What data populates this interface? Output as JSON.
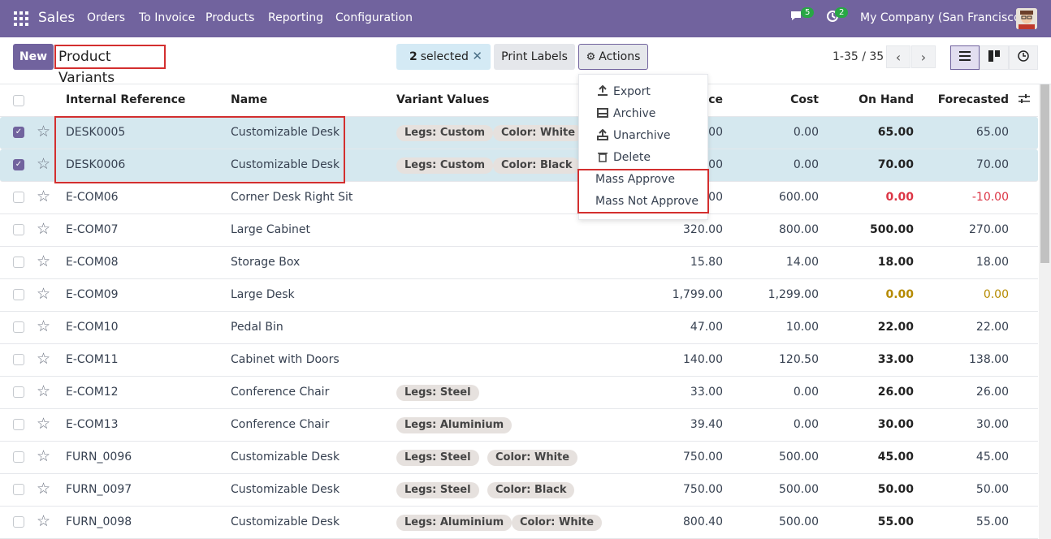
{
  "topbar": {
    "app": "Sales",
    "menus": [
      "Orders",
      "To Invoice",
      "Products",
      "Reporting",
      "Configuration"
    ],
    "chat_count": "5",
    "activity_count": "2",
    "company": "My Company (San Francisco)"
  },
  "control": {
    "new_label": "New",
    "title": "Product Variants",
    "selected_count": "2",
    "selected_label": "selected",
    "print_label": "Print Labels",
    "actions_label": "Actions",
    "pager": "1-35 / 35"
  },
  "actions_menu": [
    "Export",
    "Archive",
    "Unarchive",
    "Delete",
    "Mass Approve",
    "Mass Not Approve"
  ],
  "columns": [
    "Internal Reference",
    "Name",
    "Variant Values",
    "ice",
    "Cost",
    "On Hand",
    "Forecasted"
  ],
  "rows": [
    {
      "ref": "DESK0005",
      "name": "Customizable Desk",
      "tags": [
        "Legs: Custom",
        "Color: White"
      ],
      "price": ".00",
      "cost": "0.00",
      "onhand": "65.00",
      "forecast": "65.00",
      "selected": true
    },
    {
      "ref": "DESK0006",
      "name": "Customizable Desk",
      "tags": [
        "Legs: Custom",
        "Color: Black"
      ],
      "price": ".00",
      "cost": "0.00",
      "onhand": "70.00",
      "forecast": "70.00",
      "selected": true
    },
    {
      "ref": "E-COM06",
      "name": "Corner Desk Right Sit",
      "tags": [],
      "price": ".00",
      "cost": "600.00",
      "onhand": "0.00",
      "forecast": "-10.00",
      "status": "red"
    },
    {
      "ref": "E-COM07",
      "name": "Large Cabinet",
      "tags": [],
      "price": "320.00",
      "cost": "800.00",
      "onhand": "500.00",
      "forecast": "270.00"
    },
    {
      "ref": "E-COM08",
      "name": "Storage Box",
      "tags": [],
      "price": "15.80",
      "cost": "14.00",
      "onhand": "18.00",
      "forecast": "18.00"
    },
    {
      "ref": "E-COM09",
      "name": "Large Desk",
      "tags": [],
      "price": "1,799.00",
      "cost": "1,299.00",
      "onhand": "0.00",
      "forecast": "0.00",
      "status": "amber"
    },
    {
      "ref": "E-COM10",
      "name": "Pedal Bin",
      "tags": [],
      "price": "47.00",
      "cost": "10.00",
      "onhand": "22.00",
      "forecast": "22.00"
    },
    {
      "ref": "E-COM11",
      "name": "Cabinet with Doors",
      "tags": [],
      "price": "140.00",
      "cost": "120.50",
      "onhand": "33.00",
      "forecast": "138.00"
    },
    {
      "ref": "E-COM12",
      "name": "Conference Chair",
      "tags": [
        "Legs: Steel"
      ],
      "price": "33.00",
      "cost": "0.00",
      "onhand": "26.00",
      "forecast": "26.00"
    },
    {
      "ref": "E-COM13",
      "name": "Conference Chair",
      "tags": [
        "Legs: Aluminium"
      ],
      "price": "39.40",
      "cost": "0.00",
      "onhand": "30.00",
      "forecast": "30.00"
    },
    {
      "ref": "FURN_0096",
      "name": "Customizable Desk",
      "tags": [
        "Legs: Steel",
        "Color: White"
      ],
      "price": "750.00",
      "cost": "500.00",
      "onhand": "45.00",
      "forecast": "45.00"
    },
    {
      "ref": "FURN_0097",
      "name": "Customizable Desk",
      "tags": [
        "Legs: Steel",
        "Color: Black"
      ],
      "price": "750.00",
      "cost": "500.00",
      "onhand": "50.00",
      "forecast": "50.00"
    },
    {
      "ref": "FURN_0098",
      "name": "Customizable Desk",
      "tags": [
        "Legs: Aluminium",
        "Color: White"
      ],
      "price": "800.40",
      "cost": "500.00",
      "onhand": "55.00",
      "forecast": "55.00"
    }
  ]
}
